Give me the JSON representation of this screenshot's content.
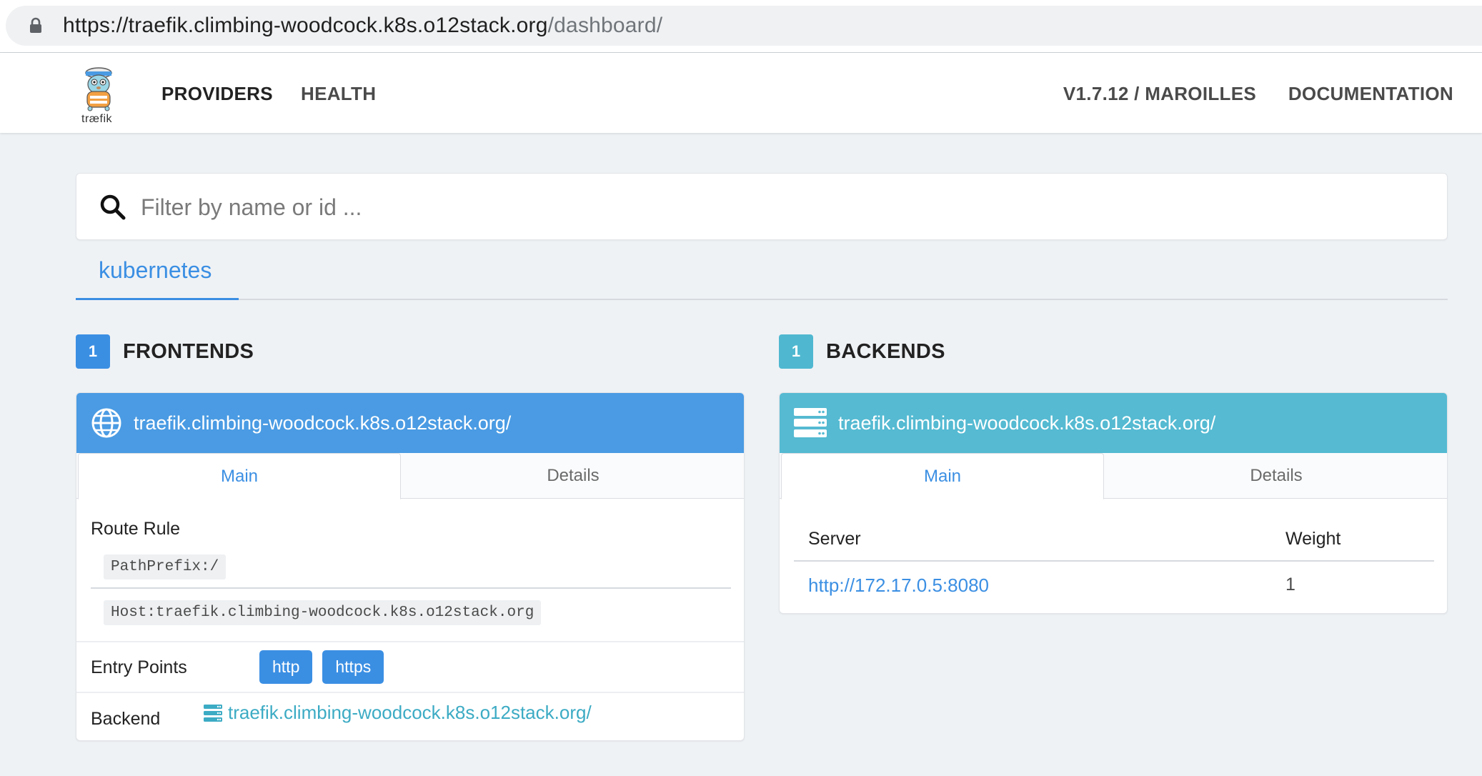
{
  "browser": {
    "url_host": "https://traefik.climbing-woodcock.k8s.o12stack.org",
    "url_path": "/dashboard/",
    "lock_icon": "lock-icon"
  },
  "navbar": {
    "logo_text": "træfik",
    "items": [
      {
        "label": "PROVIDERS",
        "active": true
      },
      {
        "label": "HEALTH",
        "active": false
      }
    ],
    "version": "V1.7.12 / MAROILLES",
    "documentation": "DOCUMENTATION"
  },
  "search": {
    "placeholder": "Filter by name or id ...",
    "value": "",
    "icon": "search-icon"
  },
  "provider_tabs": [
    {
      "label": "kubernetes",
      "active": true
    }
  ],
  "frontends": {
    "count": "1",
    "title": "FRONTENDS",
    "color": "#4a9be3",
    "card": {
      "name": "traefik.climbing-woodcock.k8s.o12stack.org/",
      "icon": "globe-icon",
      "tabs": [
        {
          "label": "Main",
          "active": true
        },
        {
          "label": "Details",
          "active": false
        }
      ],
      "route_rule_label": "Route Rule",
      "route_rules": [
        "PathPrefix:/",
        "Host:traefik.climbing-woodcock.k8s.o12stack.org"
      ],
      "entry_points_label": "Entry Points",
      "entry_points": [
        "http",
        "https"
      ],
      "backend_label": "Backend",
      "backend_value": "traefik.climbing-woodcock.k8s.o12stack.org/",
      "backend_icon": "server-icon"
    }
  },
  "backends": {
    "count": "1",
    "title": "BACKENDS",
    "color": "#55bad2",
    "card": {
      "name": "traefik.climbing-woodcock.k8s.o12stack.org/",
      "icon": "server-icon",
      "tabs": [
        {
          "label": "Main",
          "active": true
        },
        {
          "label": "Details",
          "active": false
        }
      ],
      "table": {
        "headers": [
          "Server",
          "Weight"
        ],
        "rows": [
          {
            "server": "http://172.17.0.5:8080",
            "weight": "1"
          }
        ]
      }
    }
  }
}
